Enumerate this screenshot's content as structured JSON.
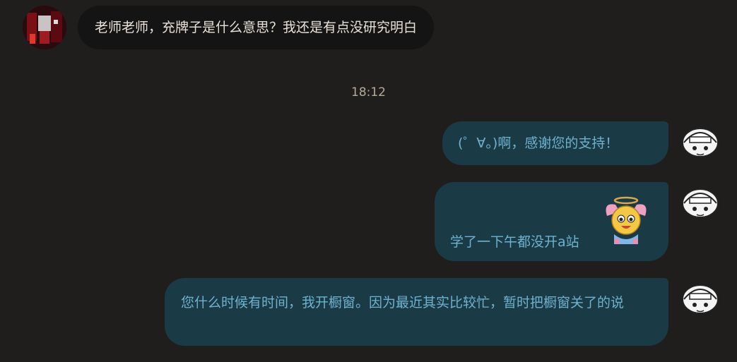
{
  "incoming": {
    "text": "老师老师，充牌子是什么意思？我还是有点没研究明白"
  },
  "timestamp": "18:12",
  "outgoing": [
    {
      "text": "(゜∀。)啊，感谢您的支持！"
    },
    {
      "text": "学了一下午都没开a站",
      "sticker": "cartoon-angel-sticker"
    },
    {
      "text": "您什么时候有时间，我开橱窗。因为最近其实比较忙，暂时把橱窗关了的说"
    }
  ],
  "icons": {
    "left_avatar": "avatar-red-dark",
    "right_avatar": "avatar-manga-girl"
  },
  "colors": {
    "background": "#1f1e1d",
    "incoming_bubble": "#141414",
    "outgoing_bubble": "#1a3a45",
    "outgoing_text": "#6fb2d0",
    "incoming_text": "#e9e1d8",
    "timestamp_text": "#b7a99a"
  }
}
